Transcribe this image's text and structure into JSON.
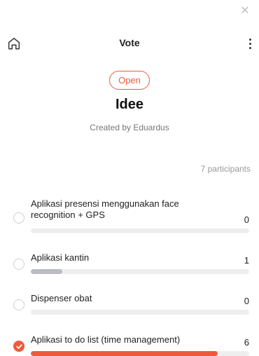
{
  "window": {
    "close_glyph": "✕"
  },
  "header": {
    "title": "Vote",
    "home_icon": "home-icon",
    "more_icon": "more-vertical-icon"
  },
  "poll": {
    "status": "Open",
    "title": "Idee",
    "created_by": "Created by Eduardus",
    "participants": "7 participants",
    "total_votes": 7
  },
  "options": [
    {
      "label": "Aplikasi presensi menggunakan face recognition + GPS",
      "count": "0",
      "votes": 0,
      "selected": false
    },
    {
      "label": "Aplikasi kantin",
      "count": "1",
      "votes": 1,
      "selected": false
    },
    {
      "label": "Dispenser obat",
      "count": "0",
      "votes": 0,
      "selected": false
    },
    {
      "label": "Aplikasi to do list (time management)",
      "count": "6",
      "votes": 6,
      "selected": true
    }
  ],
  "colors": {
    "accent": "#ef5a3c",
    "bar_default": "#b9bcc2",
    "track": "#eeeeee"
  }
}
